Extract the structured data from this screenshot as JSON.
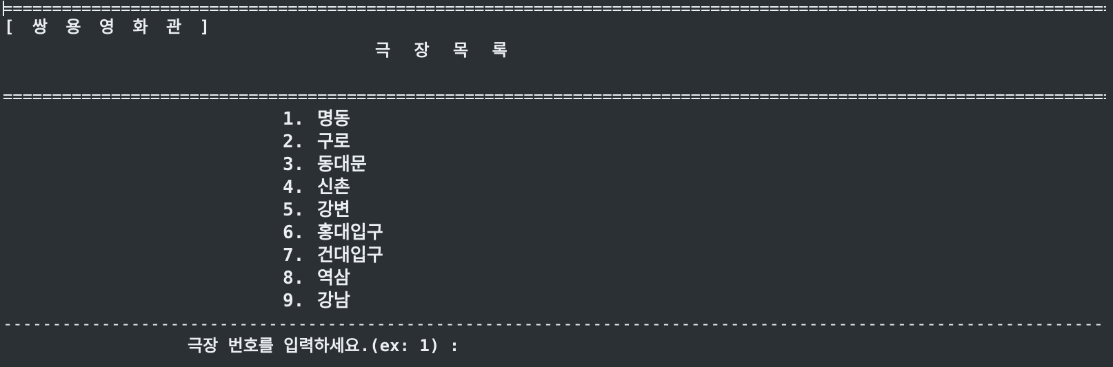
{
  "header": {
    "top_rule": "=====================================================================================================================================================================================================================================================================================================",
    "brand": "[ 쌍 용 영 화 관 ]",
    "title": "극 장 목 록",
    "mid_rule": "====================================================================================================================================================================================================================================================================================================="
  },
  "menu": {
    "items": [
      {
        "num": "1.",
        "label": "명동"
      },
      {
        "num": "2.",
        "label": "구로"
      },
      {
        "num": "3.",
        "label": "동대문"
      },
      {
        "num": "4.",
        "label": "신촌"
      },
      {
        "num": "5.",
        "label": "강변"
      },
      {
        "num": "6.",
        "label": "홍대입구"
      },
      {
        "num": "7.",
        "label": "건대입구"
      },
      {
        "num": "8.",
        "label": "역삼"
      },
      {
        "num": "9.",
        "label": "강남"
      }
    ]
  },
  "footer": {
    "dash_rule": "-----------------------------------------------------------------------------------------------------------------------------------------------------------------------------------------------------------------------------------------------------------------------------------------------------",
    "prompt": "극장 번호를 입력하세요.(ex: 1) :",
    "input_value": ""
  }
}
